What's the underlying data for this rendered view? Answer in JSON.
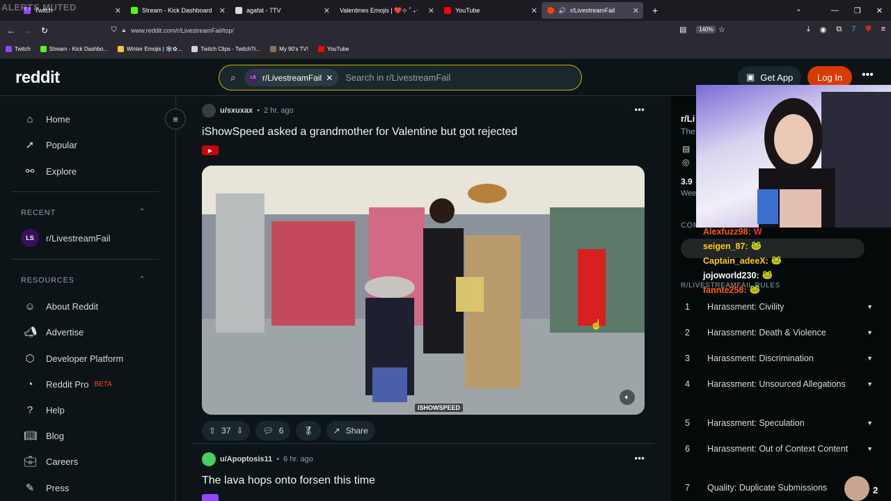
{
  "overlay": {
    "alerts_text": "ALERTS MUTED"
  },
  "browser": {
    "tabs": [
      {
        "label": "Twitch",
        "fav_color": "#9146ff"
      },
      {
        "label": "Stream - Kick Dashboard",
        "fav_color": "#53fc18"
      },
      {
        "label": "agafat - 7TV",
        "fav_color": "#d7dadc"
      },
      {
        "label": "Valentines Emojis | ❤️⊹ ˚ ₊‧",
        "fav_color": "#ff69b4"
      },
      {
        "label": "YouTube",
        "fav_color": "#ff0000"
      },
      {
        "label": "r/LivestreamFail",
        "fav_color": "#ff4500"
      }
    ],
    "url": "www.reddit.com/r/LivestreamFail/top/",
    "zoom": "140%",
    "bookmarks": [
      {
        "label": "Twitch",
        "fav_color": "#9146ff"
      },
      {
        "label": "Stream - Kick Dashbo...",
        "fav_color": "#53fc18"
      },
      {
        "label": "Winter Emojis | ❄️✿...",
        "fav_color": "#f5c242"
      },
      {
        "label": "Twitch Clips - TwitchTr...",
        "fav_color": "#cfcfd8"
      },
      {
        "label": "My 90's TV!",
        "fav_color": "#8a6e5a"
      },
      {
        "label": "YouTube",
        "fav_color": "#ff0000"
      }
    ]
  },
  "header": {
    "logo": "reddit",
    "chip_label": "r/LivestreamFail",
    "chip_avatar": "LS",
    "search_placeholder": "Search in r/LivestreamFail",
    "get_app": "Get App",
    "login": "Log In"
  },
  "sidebar": {
    "nav": [
      {
        "label": "Home",
        "icon": "home-icon"
      },
      {
        "label": "Popular",
        "icon": "popular-icon"
      },
      {
        "label": "Explore",
        "icon": "explore-icon"
      }
    ],
    "recent_header": "RECENT",
    "recent_items": [
      {
        "label": "r/LivestreamFail",
        "avatar": "LS"
      }
    ],
    "resources_header": "RESOURCES",
    "resources": [
      {
        "label": "About Reddit",
        "icon": "about-icon"
      },
      {
        "label": "Advertise",
        "icon": "advertise-icon"
      },
      {
        "label": "Developer Platform",
        "icon": "developer-icon"
      },
      {
        "label": "Reddit Pro",
        "icon": "pro-icon",
        "badge": "BETA"
      },
      {
        "label": "Help",
        "icon": "help-icon"
      },
      {
        "label": "Blog",
        "icon": "blog-icon"
      },
      {
        "label": "Careers",
        "icon": "careers-icon"
      },
      {
        "label": "Press",
        "icon": "press-icon"
      }
    ]
  },
  "posts": [
    {
      "user": "u/sxuxax",
      "time": "2 hr. ago",
      "title": "iShowSpeed asked a grandmother for Valentine but got rejected",
      "watermark": "ISHOWSPEED",
      "upvotes": "37",
      "comments": "6",
      "share": "Share"
    },
    {
      "user": "u/Apoptosis11",
      "time": "6 hr. ago",
      "title": "The lava hops onto forsen this time"
    }
  ],
  "right_panel": {
    "sub_name": "r/Li",
    "sub_desc": "The",
    "stat": "3.9",
    "stat_label": "Wee",
    "com_label": "COM",
    "rules_header": "R/LIVESTREAMFAIL RULES",
    "rules": [
      {
        "num": "1",
        "text": "Harassment: Civility"
      },
      {
        "num": "2",
        "text": "Harassment: Death & Violence"
      },
      {
        "num": "3",
        "text": "Harassment: Discrimination"
      },
      {
        "num": "4",
        "text": "Harassment: Unsourced Allegations"
      },
      {
        "num": "5",
        "text": "Harassment: Speculation"
      },
      {
        "num": "6",
        "text": "Harassment: Out of Context Content"
      },
      {
        "num": "7",
        "text": "Quality: Duplicate Submissions"
      }
    ]
  },
  "chat": [
    {
      "user": "Alexfuzz98:",
      "msg": "W",
      "color": "#ff5a00"
    },
    {
      "user": "seigen_87:",
      "msg": "",
      "color": "#ffd000"
    },
    {
      "user": "Captain_adeeX:",
      "msg": "",
      "color": "#ffd000"
    },
    {
      "user": "jojoworld230:",
      "msg": "",
      "color": "#ffffff"
    },
    {
      "user": "fannte258:",
      "msg": "",
      "color": "#ff5a00"
    }
  ],
  "corner_count": "2"
}
